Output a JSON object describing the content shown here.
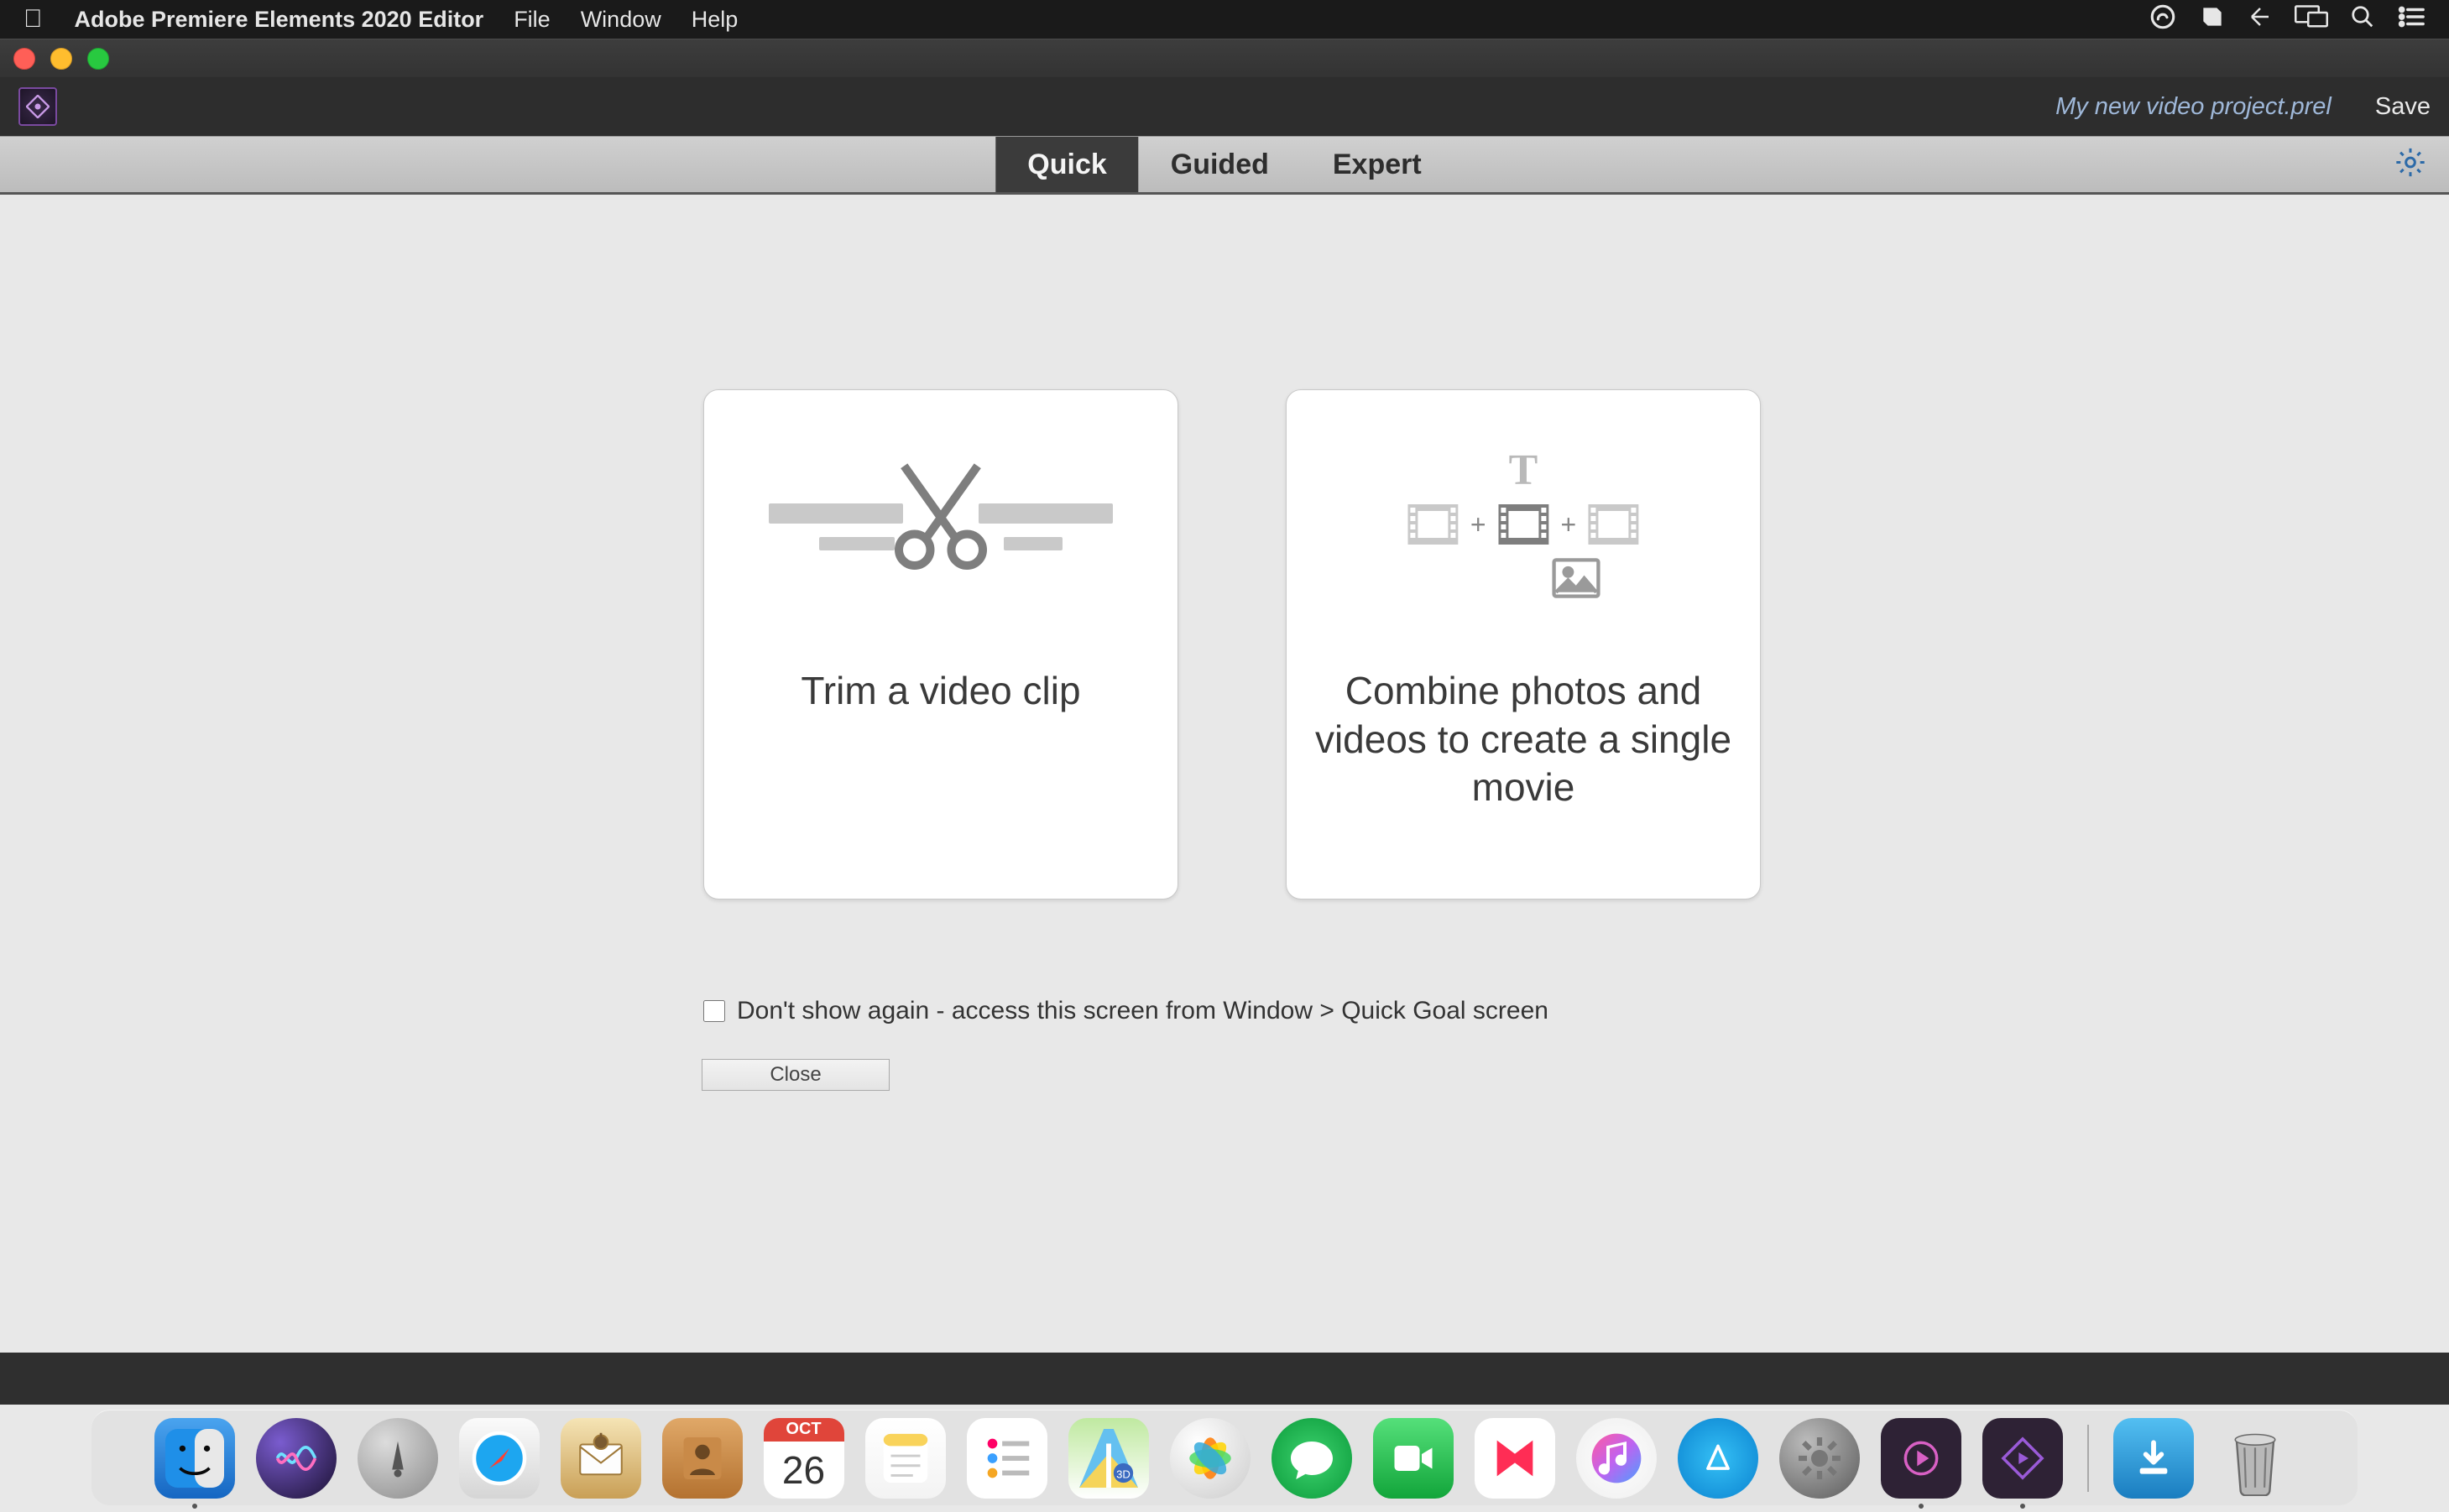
{
  "menubar": {
    "app_name": "Adobe Premiere Elements 2020 Editor",
    "items": [
      "File",
      "Window",
      "Help"
    ]
  },
  "app_bar": {
    "filename": "My new video project.prel",
    "save_label": "Save"
  },
  "mode_tabs": {
    "quick": "Quick",
    "guided": "Guided",
    "expert": "Expert"
  },
  "cards": {
    "trim": "Trim a video clip",
    "combine": "Combine photos and videos to create a single movie"
  },
  "dont_show": "Don't show again - access this screen from Window > Quick Goal screen",
  "close_label": "Close",
  "dock": {
    "date_month": "OCT",
    "date_day": "26"
  }
}
